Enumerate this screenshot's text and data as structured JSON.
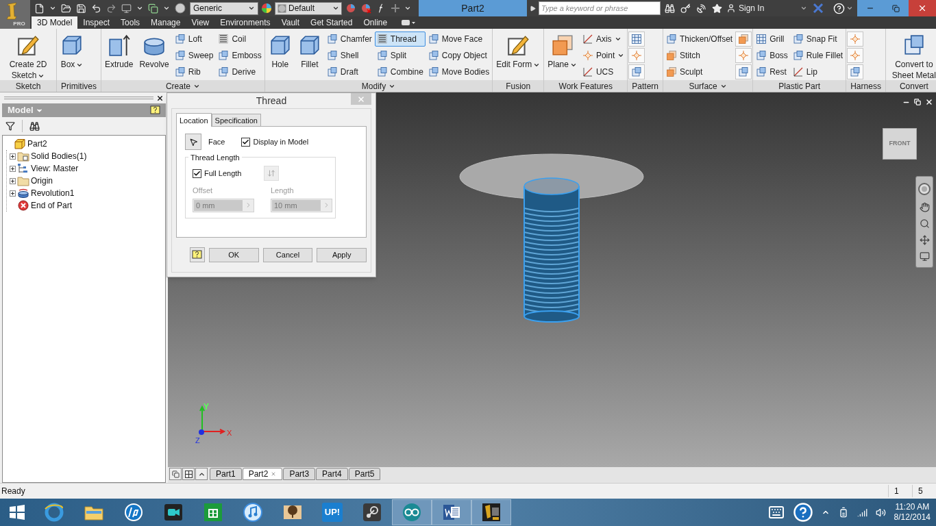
{
  "title_bar": {
    "app_badge": "PRO",
    "material": "Generic",
    "appearance": "Default",
    "document": "Part2",
    "search": {
      "placeholder": "Type a keyword or phrase"
    },
    "sign_in": "Sign In"
  },
  "ribbon_tabs": [
    {
      "label": "3D Model",
      "selected": true
    },
    {
      "label": "Inspect",
      "selected": false
    },
    {
      "label": "Tools",
      "selected": false
    },
    {
      "label": "Manage",
      "selected": false
    },
    {
      "label": "View",
      "selected": false
    },
    {
      "label": "Environments",
      "selected": false
    },
    {
      "label": "Vault",
      "selected": false
    },
    {
      "label": "Get Started",
      "selected": false
    },
    {
      "label": "Online",
      "selected": false
    }
  ],
  "ribbon": [
    {
      "title": "Sketch",
      "columns": [
        {
          "kind": "large",
          "label": "Create 2D Sketch",
          "menu": true,
          "active": false
        }
      ]
    },
    {
      "title": "Primitives",
      "columns": [
        {
          "kind": "large",
          "label": "Box",
          "menu": true,
          "active": false
        }
      ]
    },
    {
      "title": "Create",
      "menu": true,
      "columns": [
        {
          "kind": "large",
          "label": "Extrude",
          "active": false
        },
        {
          "kind": "large",
          "label": "Revolve",
          "active": false
        },
        {
          "kind": "stack",
          "tools": [
            {
              "kind": "tool",
              "label": "Loft",
              "active": false
            },
            {
              "kind": "tool",
              "label": "Sweep",
              "active": false
            },
            {
              "kind": "tool",
              "label": "Rib",
              "active": false
            }
          ]
        },
        {
          "kind": "stack",
          "tools": [
            {
              "kind": "tool",
              "label": "Coil",
              "active": false
            },
            {
              "kind": "tool",
              "label": "Emboss",
              "active": false
            },
            {
              "kind": "tool",
              "label": "Derive",
              "active": false
            }
          ]
        }
      ]
    },
    {
      "title": "Modify",
      "menu": true,
      "columns": [
        {
          "kind": "large",
          "label": "Hole",
          "active": false
        },
        {
          "kind": "large",
          "label": "Fillet",
          "active": false
        },
        {
          "kind": "stack",
          "tools": [
            {
              "kind": "tool",
              "label": "Chamfer",
              "active": false
            },
            {
              "kind": "tool",
              "label": "Shell",
              "active": false
            },
            {
              "kind": "tool",
              "label": "Draft",
              "active": false
            }
          ]
        },
        {
          "kind": "stack",
          "tools": [
            {
              "kind": "tool",
              "label": "Thread",
              "active": true
            },
            {
              "kind": "tool",
              "label": "Split",
              "active": false
            },
            {
              "kind": "tool",
              "label": "Combine",
              "active": false
            }
          ]
        },
        {
          "kind": "stack",
          "tools": [
            {
              "kind": "tool",
              "label": "Move Face",
              "active": false
            },
            {
              "kind": "tool",
              "label": "Copy Object",
              "active": false
            },
            {
              "kind": "tool",
              "label": "Move Bodies",
              "active": false
            }
          ]
        }
      ]
    },
    {
      "title": "Fusion",
      "columns": [
        {
          "kind": "large",
          "label": "Edit Form",
          "menu": true,
          "active": false
        }
      ]
    },
    {
      "title": "Work Features",
      "columns": [
        {
          "kind": "large",
          "label": "Plane",
          "menu": true,
          "active": false
        },
        {
          "kind": "stack",
          "tools": [
            {
              "kind": "tool",
              "label": "Axis",
              "menu": true,
              "active": false
            },
            {
              "kind": "tool",
              "label": "Point",
              "menu": true,
              "active": false
            },
            {
              "kind": "tool",
              "label": "UCS",
              "active": false
            }
          ]
        }
      ]
    },
    {
      "title": "Pattern",
      "columns": [
        {
          "kind": "stack",
          "tools": [
            {
              "kind": "icon",
              "active": false
            },
            {
              "kind": "icon",
              "active": false
            },
            {
              "kind": "icon",
              "active": false
            }
          ]
        }
      ]
    },
    {
      "title": "Surface",
      "menu": true,
      "columns": [
        {
          "kind": "stack",
          "tools": [
            {
              "kind": "tool",
              "label": "Thicken/Offset",
              "active": false
            },
            {
              "kind": "tool",
              "label": "Stitch",
              "active": false
            },
            {
              "kind": "tool",
              "label": "Sculpt",
              "active": false
            }
          ]
        },
        {
          "kind": "stack",
          "tools": [
            {
              "kind": "icon",
              "active": false
            },
            {
              "kind": "icon",
              "active": false
            },
            {
              "kind": "icon",
              "active": false
            }
          ]
        }
      ]
    },
    {
      "title": "Plastic Part",
      "columns": [
        {
          "kind": "stack",
          "tools": [
            {
              "kind": "tool",
              "label": "Grill",
              "active": false
            },
            {
              "kind": "tool",
              "label": "Boss",
              "active": false
            },
            {
              "kind": "tool",
              "label": "Rest",
              "active": false
            }
          ]
        },
        {
          "kind": "stack",
          "tools": [
            {
              "kind": "tool",
              "label": "Snap Fit",
              "active": false
            },
            {
              "kind": "tool",
              "label": "Rule Fillet",
              "active": false
            },
            {
              "kind": "tool",
              "label": "Lip",
              "active": false
            }
          ]
        }
      ]
    },
    {
      "title": "Harness",
      "columns": [
        {
          "kind": "stack",
          "tools": [
            {
              "kind": "icon",
              "active": false
            },
            {
              "kind": "icon",
              "active": false
            },
            {
              "kind": "icon",
              "active": false
            }
          ]
        }
      ]
    },
    {
      "title": "Convert",
      "columns": [
        {
          "kind": "large",
          "label": "Convert to Sheet Metal",
          "active": false
        }
      ]
    }
  ],
  "browser": {
    "title": "Model",
    "tree": [
      {
        "label": "Part2",
        "children": [
          {
            "label": "Solid Bodies(1)",
            "expanded": false
          },
          {
            "label": "View: Master",
            "expanded": false
          },
          {
            "label": "Origin",
            "expanded": false
          },
          {
            "label": "Revolution1",
            "expanded": false
          },
          {
            "label": "End of Part"
          }
        ]
      }
    ]
  },
  "dialog": {
    "title": "Thread",
    "tabs": [
      {
        "label": "Location",
        "selected": true
      },
      {
        "label": "Specification",
        "selected": false
      }
    ],
    "selector": {
      "label": "Face"
    },
    "display_in_model": {
      "label": "Display in Model",
      "checked": true
    },
    "thread_length": {
      "title": "Thread Length",
      "full_length": {
        "label": "Full Length",
        "checked": true
      },
      "offset": {
        "label": "Offset",
        "value": "0 mm",
        "disabled": true
      },
      "length": {
        "label": "Length",
        "value": "10 mm",
        "disabled": true
      }
    },
    "buttons": [
      "OK",
      "Cancel",
      "Apply"
    ]
  },
  "viewport": {
    "view_cube": "FRONT",
    "axes": {
      "x": "X",
      "y": "Y",
      "z": "Z"
    }
  },
  "document_tabs": [
    {
      "label": "Part1",
      "selected": false
    },
    {
      "label": "Part2",
      "selected": true
    },
    {
      "label": "Part3",
      "selected": false
    },
    {
      "label": "Part4",
      "selected": false
    },
    {
      "label": "Part5",
      "selected": false
    }
  ],
  "status_bar": {
    "message": "Ready",
    "cells": [
      "1",
      "5"
    ]
  },
  "taskbar": {
    "apps": [
      {
        "kind": "ie",
        "running": false
      },
      {
        "kind": "explorer",
        "running": false
      },
      {
        "kind": "hp",
        "running": false
      },
      {
        "kind": "video",
        "running": false
      },
      {
        "kind": "store",
        "running": false
      },
      {
        "kind": "music",
        "running": false
      },
      {
        "kind": "tree",
        "running": false
      },
      {
        "kind": "up",
        "label": "UP!",
        "running": false
      },
      {
        "kind": "steam",
        "running": false
      },
      {
        "kind": "arduino",
        "running": true
      },
      {
        "kind": "word",
        "running": true
      },
      {
        "kind": "inventor",
        "running": true
      }
    ],
    "time": "11:20 AM",
    "date": "8/12/2014"
  }
}
